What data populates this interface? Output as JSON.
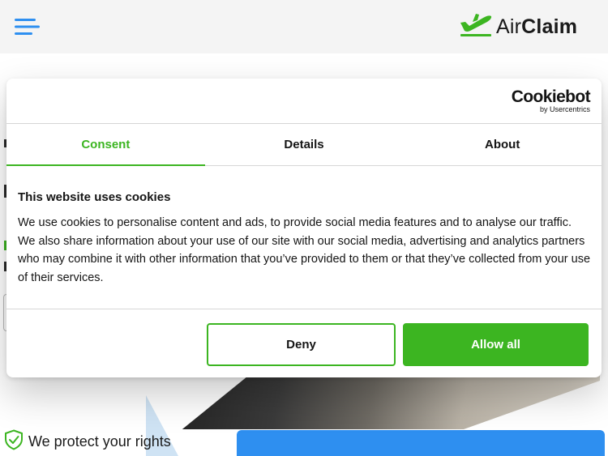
{
  "header": {
    "menu_icon": "hamburger-menu-icon",
    "logo_icon": "airplane-takeoff-icon",
    "logo_text_light": "Air",
    "logo_text_bold": "Claim"
  },
  "colors": {
    "brand_green": "#3cb521",
    "accent_blue": "#2e8ff0",
    "text": "#141414"
  },
  "cookie_dialog": {
    "brand": "Cookiebot",
    "brand_sub": "by Usercentrics",
    "tabs": [
      {
        "label": "Consent",
        "active": true
      },
      {
        "label": "Details",
        "active": false
      },
      {
        "label": "About",
        "active": false
      }
    ],
    "title": "This website uses cookies",
    "body": "We use cookies to personalise content and ads, to provide social media features and to analyse our traffic. We also share information about your use of our site with our social media, advertising and analytics partners who may combine it with other information that you’ve provided to them or that they’ve collected from your use of their services.",
    "deny_label": "Deny",
    "allow_label": "Allow all"
  },
  "page": {
    "trust_icon": "shield-check-icon",
    "trust_text": "We protect your rights"
  }
}
